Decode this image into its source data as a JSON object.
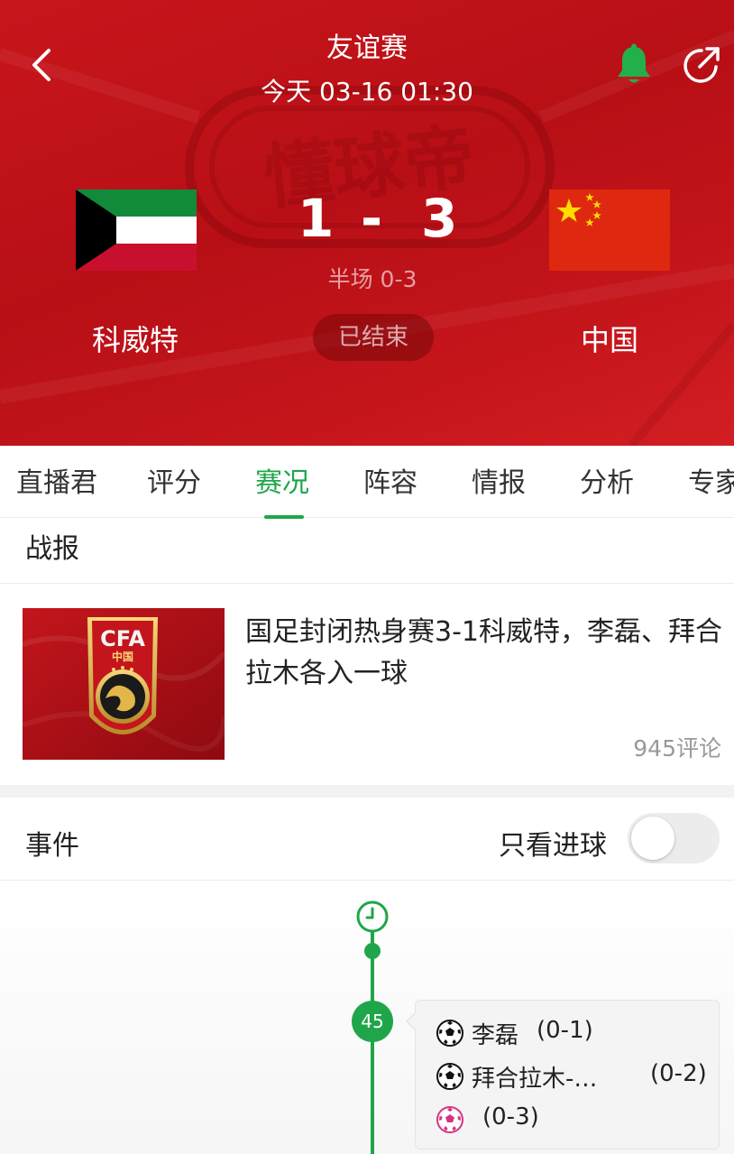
{
  "header": {
    "title": "友谊赛",
    "datetime": "今天 03-16 01:30",
    "watermark": "懂球帝",
    "score": {
      "home": "1",
      "separator": "-",
      "away": "3"
    },
    "halftime": "半场 0-3",
    "home_team": "科威特",
    "away_team": "中国",
    "status": "已结束",
    "icons": {
      "back": "back-arrow-icon",
      "bell": "bell-icon",
      "share": "share-icon"
    },
    "colors": {
      "header_bg": "#c8161c",
      "accent": "#1fa64a"
    }
  },
  "tabs": [
    "直播君",
    "评分",
    "赛况",
    "阵容",
    "情报",
    "分析",
    "专家"
  ],
  "active_tab": "赛况",
  "report": {
    "heading": "战报",
    "news": {
      "thumb_logo_text": "CFA",
      "thumb_logo_sub": "中国",
      "title": "国足封闭热身赛3-1科威特，李磊、拜合拉木各入一球",
      "comments": "945评论"
    }
  },
  "events": {
    "heading": "事件",
    "goals_only_label": "只看进球",
    "goals_only_on": false,
    "minute": "45",
    "items": [
      {
        "player": "李磊",
        "score": "(0-1)",
        "type": "goal"
      },
      {
        "player": "拜合拉木-…",
        "score": "(0-2)",
        "type": "goal"
      },
      {
        "player": "",
        "score": "(0-3)",
        "type": "own-goal"
      }
    ]
  }
}
